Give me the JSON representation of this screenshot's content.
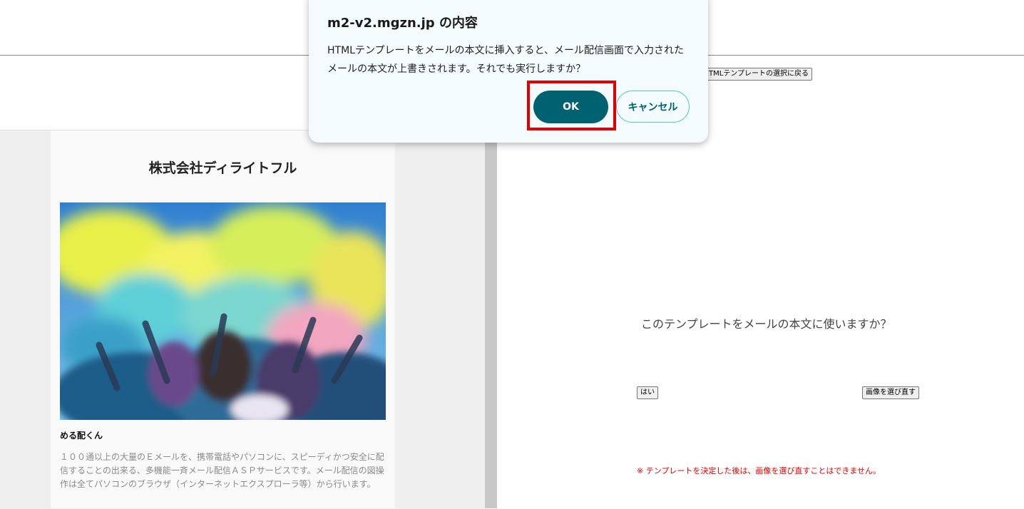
{
  "dialog": {
    "title": "m2-v2.mgzn.jp の内容",
    "message": "HTMLテンプレートをメールの本文に挿入すると、メール配信画面で入力されたメールの本文が上書きされます。それでも実行しますか？",
    "ok_label": "OK",
    "cancel_label": "キャンセル"
  },
  "page": {
    "back_button_label": "HTMLテンプレートの選択に戻る",
    "question": "このテンプレートをメールの本文に使いますか？",
    "yes_label": "はい",
    "reselect_label": "画像を選び直す",
    "warning": "※ テンプレートを決定した後は、画像を選び直すことはできません。"
  },
  "preview": {
    "company": "株式会社ディライトフル",
    "brand": "める配くん",
    "description": "１００通以上の大量のＥメールを、携帯電話やパソコンに、スピーディかつ安全に配信することの出来る、多機能一斉メール配信ＡＳＰサービスです。メール配信の図操作は全てパソコンのブラウザ（インターネットエクスプローラ等）から行います。"
  },
  "colors": {
    "ok_button": "#006270",
    "cancel_border": "#58c5cc",
    "highlight": "#e00000",
    "warning": "#e00000"
  }
}
